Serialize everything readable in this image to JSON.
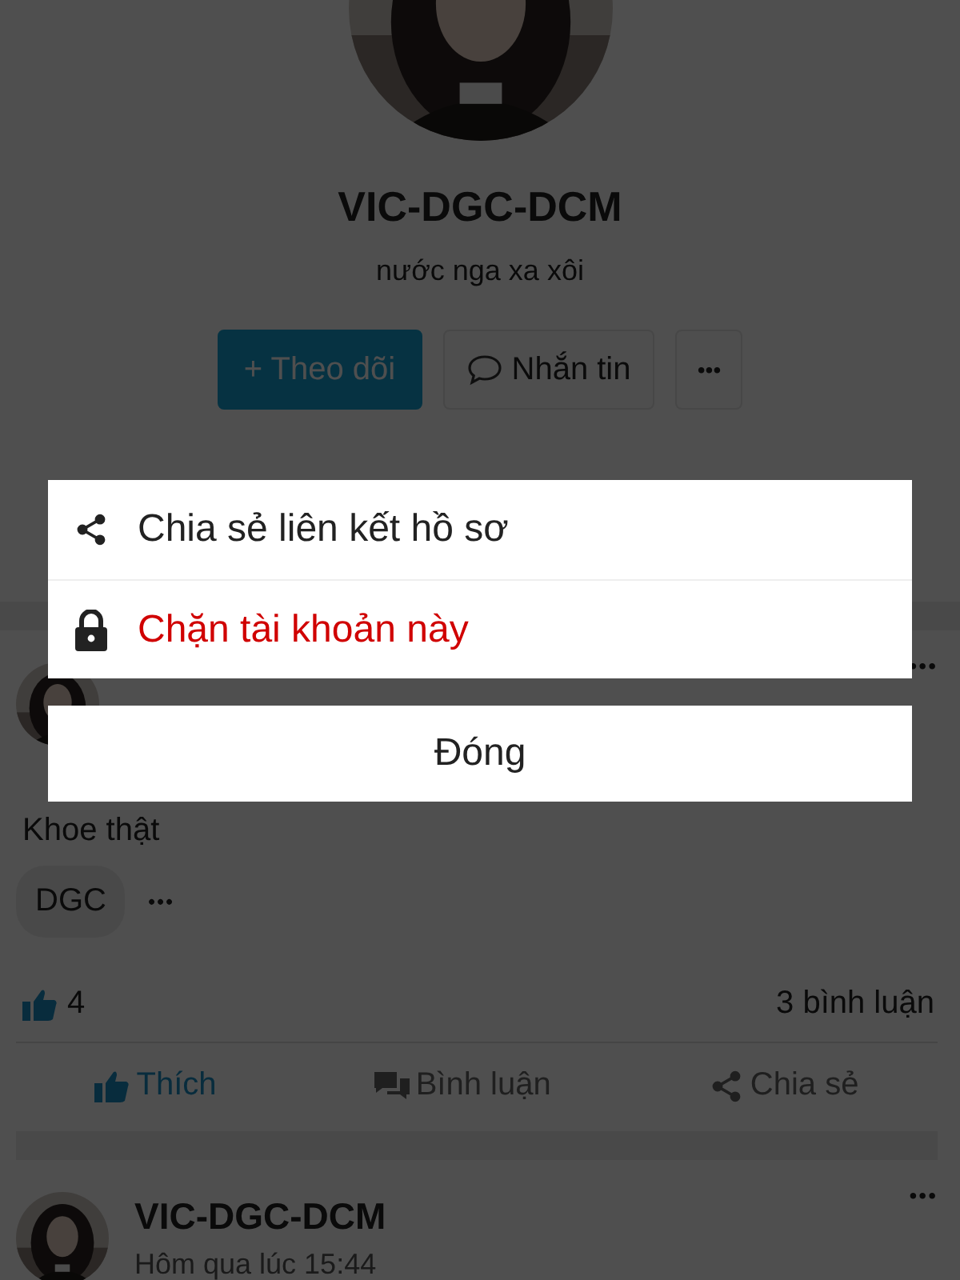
{
  "profile": {
    "name": "VIC-DGC-DCM",
    "bio": "nước nga xa xôi",
    "follow_button": "+ Theo dõi",
    "message_button": "Nhắn tin",
    "more_button": "•••"
  },
  "posts": [
    {
      "text": "Khoe thật",
      "tags": [
        "DGC"
      ],
      "tag_more": "•••",
      "likes": "4",
      "comments": "3 bình luận",
      "actions": [
        {
          "kind": "like",
          "label": "Thích",
          "selected": true
        },
        {
          "kind": "comment",
          "label": "Bình luận",
          "selected": false
        },
        {
          "kind": "share",
          "label": "Chia sẻ",
          "selected": false
        }
      ],
      "menu": "•••"
    },
    {
      "author": "VIC-DGC-DCM",
      "time": "Hôm qua lúc 15:44",
      "menu": "•••"
    }
  ],
  "action_sheet": {
    "items": [
      {
        "kind": "share",
        "label": "Chia sẻ liên kết hồ sơ",
        "danger": false
      },
      {
        "kind": "lock",
        "label": "Chặn tài khoản này",
        "danger": true
      }
    ],
    "cancel": "Đóng"
  }
}
